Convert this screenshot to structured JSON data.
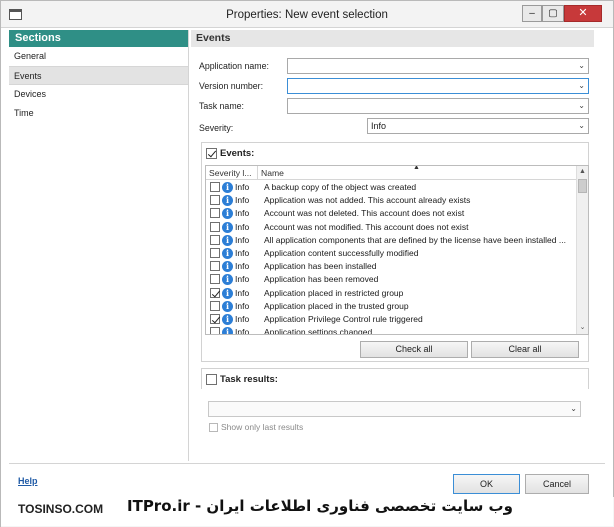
{
  "window": {
    "title": "Properties: New event selection",
    "controls": {
      "minimize": "‒",
      "maximize": "▢",
      "close": "✕"
    }
  },
  "sidebar": {
    "header": "Sections",
    "items": [
      {
        "label": "General",
        "active": false
      },
      {
        "label": "Events",
        "active": true
      },
      {
        "label": "Devices",
        "active": false
      },
      {
        "label": "Time",
        "active": false
      }
    ]
  },
  "main": {
    "header": "Events",
    "form": {
      "application_name": {
        "label": "Application name:",
        "value": ""
      },
      "version_number": {
        "label": "Version number:",
        "value": ""
      },
      "task_name": {
        "label": "Task name:",
        "value": ""
      },
      "severity": {
        "label": "Severity:",
        "value": "Info"
      }
    },
    "events_group": {
      "title": "Events:",
      "checked": true,
      "columns": [
        "Severity l...",
        "Name"
      ],
      "rows": [
        {
          "checked": false,
          "severity": "Info",
          "name": "A backup copy of the object was created"
        },
        {
          "checked": false,
          "severity": "Info",
          "name": "Application was not added. This account already exists"
        },
        {
          "checked": false,
          "severity": "Info",
          "name": "Account was not deleted. This account does not exist"
        },
        {
          "checked": false,
          "severity": "Info",
          "name": "Account was not modified. This account does not exist"
        },
        {
          "checked": false,
          "severity": "Info",
          "name": "All application components that are defined by the license have been installed ..."
        },
        {
          "checked": false,
          "severity": "Info",
          "name": "Application content successfully modified"
        },
        {
          "checked": false,
          "severity": "Info",
          "name": "Application has been installed"
        },
        {
          "checked": false,
          "severity": "Info",
          "name": "Application has been removed"
        },
        {
          "checked": true,
          "severity": "Info",
          "name": "Application placed in restricted group"
        },
        {
          "checked": false,
          "severity": "Info",
          "name": "Application placed in the trusted group"
        },
        {
          "checked": true,
          "severity": "Info",
          "name": "Application Privilege Control rule triggered"
        },
        {
          "checked": false,
          "severity": "Info",
          "name": "Application settings changed"
        }
      ],
      "check_all": "Check all",
      "clear_all": "Clear all",
      "info_glyph": "i"
    },
    "task_results": {
      "title": "Task results:",
      "checked": false,
      "dropdown_value": "",
      "show_only_last": "Show only last results"
    }
  },
  "footer": {
    "help": "Help",
    "ok": "OK",
    "cancel": "Cancel"
  },
  "watermark": {
    "left": "TOSINSO.COM",
    "right": "وب سایت تخصصی فناوری اطلاعات ایران - ITPro.ir"
  }
}
